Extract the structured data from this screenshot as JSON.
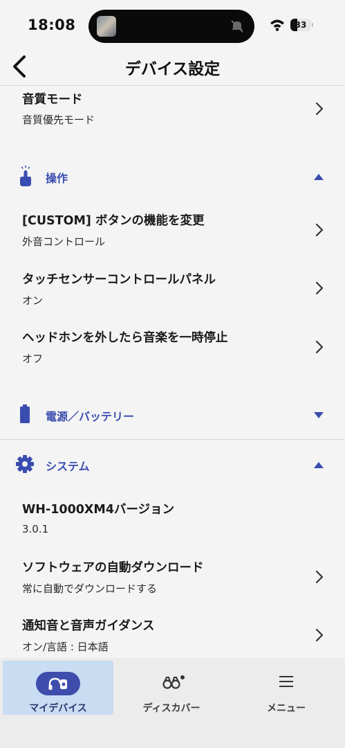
{
  "status": {
    "time": "18:08",
    "battery": "33"
  },
  "header": {
    "title": "デバイス設定"
  },
  "items": {
    "sound_mode": {
      "title": "音質モード",
      "sub": "音質優先モード"
    },
    "custom_button": {
      "title": "[CUSTOM] ボタンの機能を変更",
      "sub": "外音コントロール"
    },
    "touch_panel": {
      "title": "タッチセンサーコントロールパネル",
      "sub": "オン"
    },
    "auto_pause": {
      "title": "ヘッドホンを外したら音楽を一時停止",
      "sub": "オフ"
    },
    "version": {
      "title": "WH-1000XM4バージョン",
      "sub": "3.0.1"
    },
    "software_dl": {
      "title": "ソフトウェアの自動ダウンロード",
      "sub": "常に自動でダウンロードする"
    },
    "notification": {
      "title": "通知音と音声ガイダンス",
      "sub": "オン/言語 : 日本語"
    }
  },
  "sections": {
    "operation": {
      "label": "操作",
      "state": "expanded"
    },
    "power": {
      "label": "電源／バッテリー",
      "state": "collapsed"
    },
    "system": {
      "label": "システム",
      "state": "expanded"
    }
  },
  "tabs": [
    {
      "label": "マイデバイス",
      "icon": "headphones-icon",
      "active": true
    },
    {
      "label": "ディスカバー",
      "icon": "binoculars-icon",
      "active": false
    },
    {
      "label": "メニュー",
      "icon": "hamburger-icon",
      "active": false
    }
  ],
  "colors": {
    "accent": "#3a4cb0",
    "active_tab_bg": "#c8dcf2",
    "background": "#f3f4f3"
  }
}
